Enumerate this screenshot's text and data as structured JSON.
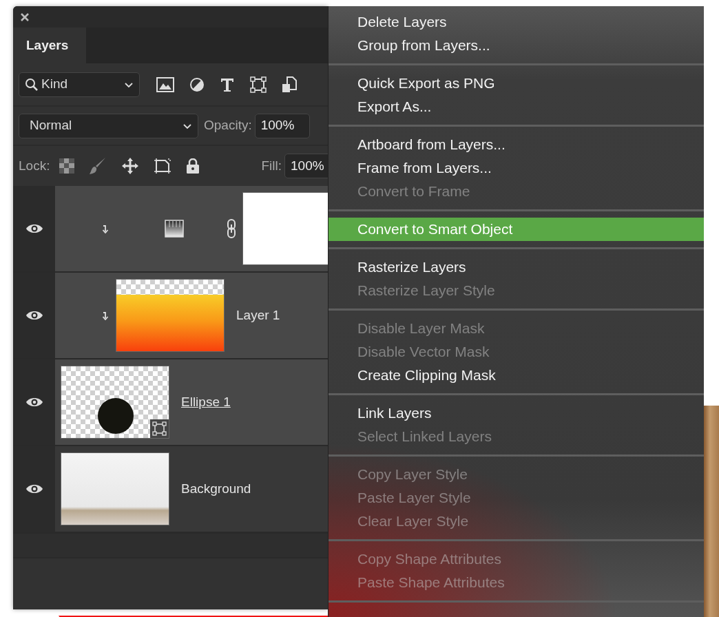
{
  "panel": {
    "tabs": [
      {
        "label": "Layers",
        "selected": true
      }
    ],
    "filter": {
      "value": "Kind"
    },
    "blend_mode": {
      "value": "Normal"
    },
    "opacity": {
      "label": "Opacity:",
      "value": "100%"
    },
    "lock_label": "Lock:",
    "fill": {
      "label": "Fill:",
      "value": "100%"
    },
    "layers": [
      {
        "kind": "gradient_fill",
        "visible": true,
        "clipped": true,
        "selected": true
      },
      {
        "kind": "pixel",
        "name": "Layer 1",
        "visible": true,
        "clipped": true,
        "selected": true
      },
      {
        "kind": "shape",
        "name": "Ellipse 1",
        "visible": true,
        "clipped": false,
        "selected": true,
        "underlined": true
      },
      {
        "kind": "photo",
        "name": "Background",
        "visible": true,
        "clipped": false,
        "selected": false
      }
    ]
  },
  "context_menu": {
    "groups": [
      {
        "items": [
          {
            "label": "Delete Layers",
            "disabled": false,
            "selected": false
          },
          {
            "label": "Group from Layers...",
            "disabled": false,
            "selected": false
          }
        ]
      },
      {
        "items": [
          {
            "label": "Quick Export as PNG",
            "disabled": false,
            "selected": false
          },
          {
            "label": "Export As...",
            "disabled": false,
            "selected": false
          }
        ]
      },
      {
        "items": [
          {
            "label": "Artboard from Layers...",
            "disabled": false,
            "selected": false
          },
          {
            "label": "Frame from Layers...",
            "disabled": false,
            "selected": false
          },
          {
            "label": "Convert to Frame",
            "disabled": true,
            "selected": false
          }
        ]
      },
      {
        "items": [
          {
            "label": "Convert to Smart Object",
            "disabled": false,
            "selected": true
          }
        ]
      },
      {
        "items": [
          {
            "label": "Rasterize Layers",
            "disabled": false,
            "selected": false
          },
          {
            "label": "Rasterize Layer Style",
            "disabled": true,
            "selected": false
          }
        ]
      },
      {
        "items": [
          {
            "label": "Disable Layer Mask",
            "disabled": true,
            "selected": false
          },
          {
            "label": "Disable Vector Mask",
            "disabled": true,
            "selected": false
          },
          {
            "label": "Create Clipping Mask",
            "disabled": false,
            "selected": false
          }
        ]
      },
      {
        "items": [
          {
            "label": "Link Layers",
            "disabled": false,
            "selected": false
          },
          {
            "label": "Select Linked Layers",
            "disabled": true,
            "selected": false
          }
        ]
      },
      {
        "items": [
          {
            "label": "Copy Layer Style",
            "disabled": true,
            "selected": false
          },
          {
            "label": "Paste Layer Style",
            "disabled": true,
            "selected": false
          },
          {
            "label": "Clear Layer Style",
            "disabled": true,
            "selected": false
          }
        ]
      },
      {
        "items": [
          {
            "label": "Copy Shape Attributes",
            "disabled": true,
            "selected": false
          },
          {
            "label": "Paste Shape Attributes",
            "disabled": true,
            "selected": false
          }
        ]
      }
    ]
  }
}
